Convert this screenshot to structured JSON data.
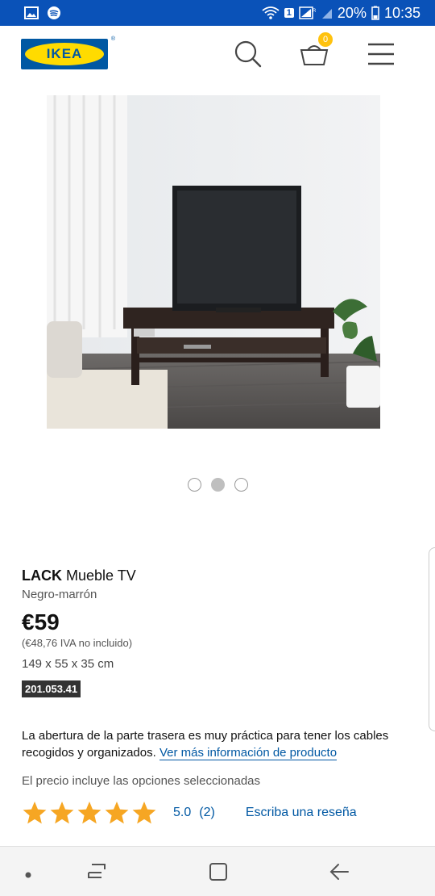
{
  "status_bar": {
    "battery": "20%",
    "time": "10:35",
    "sim": "1"
  },
  "header": {
    "logo_text": "IKEA",
    "logo_registered": "®",
    "cart_count": "0"
  },
  "carousel": {
    "slides": 3,
    "active_index": 1
  },
  "product": {
    "brand": "LACK",
    "name": " Mueble TV",
    "color": "Negro-marrón",
    "price": "€59",
    "price_note": "(€48,76 IVA no incluido)",
    "dimensions": "149 x 55 x 35 cm",
    "article_number": "201.053.41",
    "description": "La abertura de la parte trasera es muy práctica para tener los cables recogidos y organizados.",
    "more_info_link": "Ver más información de producto",
    "price_note_options": "El precio incluye las opciones seleccionadas"
  },
  "rating": {
    "score": "5.0",
    "count": "(2)",
    "stars": 5,
    "write_review": "Escriba una reseña"
  },
  "colors": {
    "status_bar": "#0a52b8",
    "ikea_blue": "#0058a3",
    "ikea_yellow": "#ffdb00",
    "star": "#f6a623",
    "badge": "#ffc20e"
  }
}
